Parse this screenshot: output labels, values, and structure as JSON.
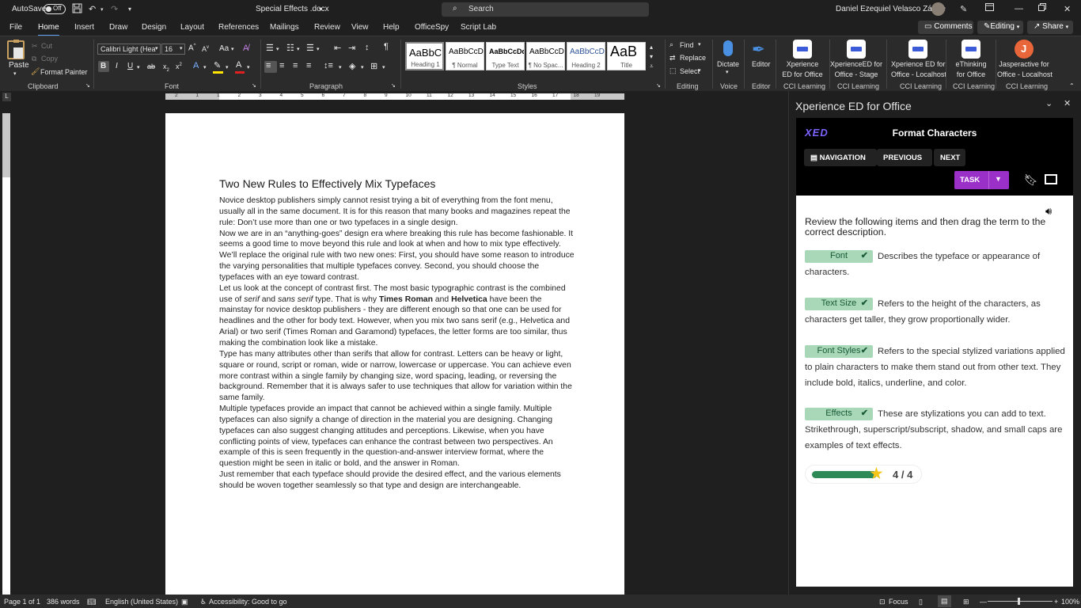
{
  "titlebar": {
    "autosave_label": "AutoSave",
    "autosave_state": "Off",
    "doc_title": "Special Effects .docx",
    "search_placeholder": "Search",
    "user_name": "Daniel Ezequiel Velasco Zárate"
  },
  "menu": {
    "tabs": [
      "File",
      "Home",
      "Insert",
      "Draw",
      "Design",
      "Layout",
      "References",
      "Mailings",
      "Review",
      "View",
      "Help",
      "OfficeSpy",
      "Script Lab"
    ],
    "active_tab": "Home",
    "comments_label": "Comments",
    "editing_label": "Editing",
    "share_label": "Share"
  },
  "ribbon": {
    "clipboard": {
      "paste": "Paste",
      "cut": "Cut",
      "copy": "Copy",
      "format_painter": "Format Painter",
      "label": "Clipboard"
    },
    "font": {
      "name": "Calibri Light (Hea",
      "size": "16",
      "label": "Font"
    },
    "paragraph": {
      "label": "Paragraph"
    },
    "styles": {
      "label": "Styles",
      "items": [
        {
          "preview": "AaBbC",
          "name": "Heading 1"
        },
        {
          "preview": "AaBbCcD",
          "name": "¶ Normal"
        },
        {
          "preview": "AaBbCcDd",
          "name": "Type Text"
        },
        {
          "preview": "AaBbCcD",
          "name": "¶ No Spac..."
        },
        {
          "preview": "AaBbCcD",
          "name": "Heading 2"
        },
        {
          "preview": "AaB",
          "name": "Title"
        }
      ]
    },
    "editing": {
      "find": "Find",
      "replace": "Replace",
      "select": "Select",
      "label": "Editing"
    },
    "voice": {
      "dictate": "Dictate",
      "label": "Voice"
    },
    "editor": {
      "editor": "Editor",
      "label": "Editor"
    },
    "addins": [
      {
        "line1": "Xperience",
        "line2": "ED for Office",
        "group": "CCI Learning"
      },
      {
        "line1": "XperienceED for",
        "line2": "Office - Stage",
        "group": "CCI Learning"
      },
      {
        "line1": "Xperience ED for",
        "line2": "Office - Localhost",
        "group": "CCI Learning"
      },
      {
        "line1": "eThinking",
        "line2": "for Office",
        "group": "CCI Learning"
      },
      {
        "line1": "Jasperactive for",
        "line2": "Office - Localhost",
        "group": "CCI Learning"
      }
    ]
  },
  "ruler": {
    "ticks": [
      "2",
      "1",
      "1",
      "2",
      "3",
      "4",
      "5",
      "6",
      "7",
      "8",
      "9",
      "10",
      "11",
      "12",
      "13",
      "14",
      "15",
      "16",
      "17",
      "18",
      "19"
    ]
  },
  "document": {
    "title": "Two New Rules to Effectively Mix Typefaces",
    "paragraphs": [
      "Novice desktop publishers simply cannot resist trying a bit of everything from the font menu, usually all in the same document. It is for this reason that many books and magazines repeat the rule: Don’t use more than one or two typefaces in a single design.",
      "Now we are in an “anything-goes” design era where breaking this rule has become fashionable. It seems a good time to move beyond this rule and look at when and how to mix type effectively. We’ll replace the original rule with two new ones: First, you should have some reason to introduce the varying personalities that multiple typefaces convey. Second, you should choose the typefaces with an eye toward contrast.",
      "Type has many attributes other than serifs that allow for contrast. Letters can be heavy or light, square or round, script or roman, wide or narrow, lowercase or uppercase. You can achieve even more contrast within a single family by changing size, word spacing, leading, or reversing the background. Remember that it is always safer to use techniques that allow for variation within the same family.",
      "Multiple typefaces provide an impact that cannot be achieved within a single family. Multiple typefaces can also signify a change of direction in the material you are designing. Changing typefaces can also suggest changing attitudes and perceptions. Likewise, when you have conflicting points of view, typefaces can enhance the contrast between two perspectives. An example of this is seen frequently in the question-and-answer interview format, where the question might be seen in italic or bold, and the answer in Roman.",
      "Just remember that each typeface should provide the desired effect, and the various elements should be woven together seamlessly so that type and design are interchangeable."
    ],
    "para3": {
      "a": "Let us look at the concept of contrast first. The most basic typographic contrast is the combined use of ",
      "serif": "serif",
      "b": " and ",
      "sans_serif": "sans serif",
      "c": " type. That is why ",
      "times": "Times Roman",
      "d": " and ",
      "helvetica": "Helvetica",
      "e": " have been the mainstay for novice desktop publishers - they are different enough so that one can be used for headlines and the other for body text. However, when you mix two sans serif (e.g., Helvetica and Arial) or two serif (Times Roman and Garamond) typefaces, the letter forms are too similar, thus making the combination look like a mistake."
    }
  },
  "pane": {
    "title": "Xperience ED for Office",
    "logo": "XED",
    "heading": "Format Characters",
    "nav_label": "NAVIGATION",
    "prev_label": "PREVIOUS",
    "next_label": "NEXT",
    "task_label": "TASK",
    "instruction": "Review the following items and then drag the term to the correct description.",
    "items": [
      {
        "term": "Font",
        "description": "Describes the typeface or appearance of characters."
      },
      {
        "term": "Text Size",
        "description": "Refers to the height of the characters, as characters get taller, they grow proportionally wider."
      },
      {
        "term": "Font Styles",
        "description": "Refers to the special stylized variations applied to plain characters to make them stand out from other text. They include bold, italics, underline, and color."
      },
      {
        "term": "Effects",
        "description": "These are stylizations you can add to text. Strikethrough, superscript/subscript, shadow, and small caps are examples of text effects."
      }
    ],
    "progress": {
      "done": 4,
      "total": 4,
      "label": "4 / 4",
      "fraction": 1.0
    },
    "accent": "#9b30c8",
    "term_color": "#a8d8b8"
  },
  "status": {
    "page": "Page 1 of 1",
    "words": "386 words",
    "language": "English (United States)",
    "accessibility": "Accessibility: Good to go",
    "focus": "Focus",
    "zoom": "100%"
  }
}
